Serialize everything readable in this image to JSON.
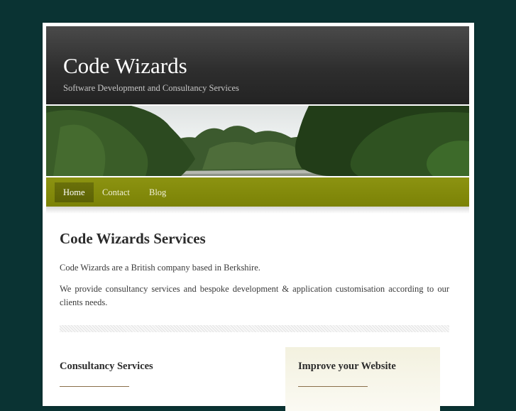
{
  "site": {
    "title": "Code Wizards",
    "tagline": "Software Development and Consultancy Services"
  },
  "nav": {
    "items": [
      {
        "label": "Home",
        "active": true
      },
      {
        "label": "Contact",
        "active": false
      },
      {
        "label": "Blog",
        "active": false
      }
    ]
  },
  "main": {
    "heading": "Code Wizards Services",
    "paragraphs": [
      "Code Wizards are a British company based in Berkshire.",
      "We provide consultancy services and bespoke development & application customisation according to our clients needs."
    ]
  },
  "columns": {
    "left_heading": "Consultancy Services",
    "right_heading": "Improve your Website"
  },
  "colors": {
    "page_background": "#0a3333",
    "nav_green": "#838a0b",
    "header_dark": "#2e2e2e"
  },
  "banner": {
    "image": "river-landscape-photo"
  }
}
